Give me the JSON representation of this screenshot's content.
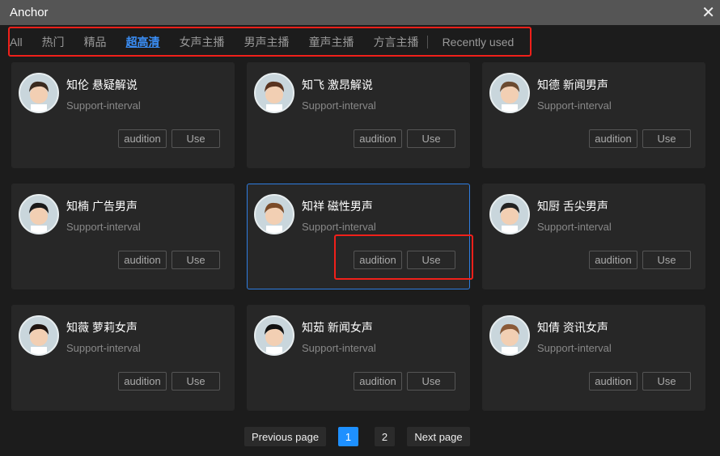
{
  "window": {
    "title": "Anchor",
    "close_icon": "close-icon"
  },
  "tabs": [
    {
      "label": "All"
    },
    {
      "label": "热门"
    },
    {
      "label": "精品"
    },
    {
      "label": "超高清",
      "active": true
    },
    {
      "label": "女声主播"
    },
    {
      "label": "男声主播"
    },
    {
      "label": "童声主播"
    },
    {
      "label": "方言主播"
    },
    {
      "label": "Recently used"
    }
  ],
  "accent": "#3a8ef6",
  "anchors": [
    {
      "name": "知伦 悬疑解说",
      "sub": "Support-interval",
      "audition": "audition",
      "use": "Use"
    },
    {
      "name": "知飞 激昂解说",
      "sub": "Support-interval",
      "audition": "audition",
      "use": "Use"
    },
    {
      "name": "知德 新闻男声",
      "sub": "Support-interval",
      "audition": "audition",
      "use": "Use"
    },
    {
      "name": "知楠 广告男声",
      "sub": "Support-interval",
      "audition": "audition",
      "use": "Use"
    },
    {
      "name": "知祥 磁性男声",
      "sub": "Support-interval",
      "audition": "audition",
      "use": "Use",
      "selected": true
    },
    {
      "name": "知厨 舌尖男声",
      "sub": "Support-interval",
      "audition": "audition",
      "use": "Use"
    },
    {
      "name": "知薇 萝莉女声",
      "sub": "Support-interval",
      "audition": "audition",
      "use": "Use"
    },
    {
      "name": "知茹 新闻女声",
      "sub": "Support-interval",
      "audition": "audition",
      "use": "Use"
    },
    {
      "name": "知倩 资讯女声",
      "sub": "Support-interval",
      "audition": "audition",
      "use": "Use"
    }
  ],
  "pagination": {
    "prev": "Previous page",
    "pages": [
      "1",
      "2"
    ],
    "current": "1",
    "next": "Next page"
  }
}
